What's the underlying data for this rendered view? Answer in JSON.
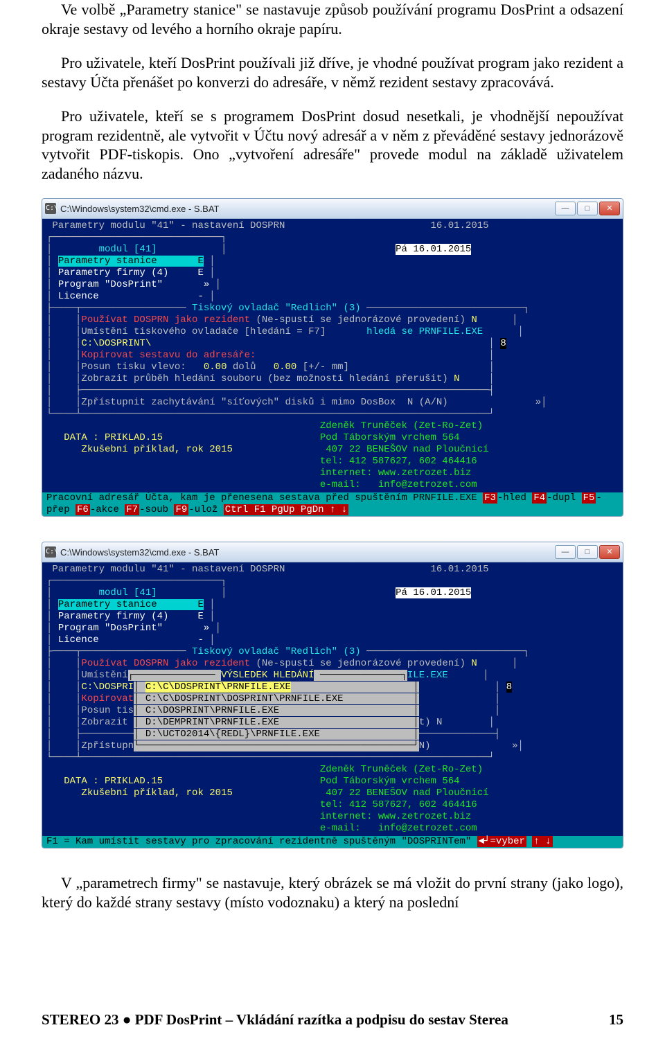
{
  "paragraphs": {
    "p1": "Ve volbě „Parametry stanice\" se nastavuje způsob používání programu DosPrint a odsazení okraje sestavy od levého a horního okraje papíru.",
    "p2": "Pro uživatele, kteří DosPrint používali již dříve, je vhodné používat program jako rezident a sestavy Účta přenášet po konverzi do adresáře, v němž rezident sestavy zpracovává.",
    "p3": "Pro uživatele, kteří se s programem DosPrint dosud nesetkali, je vhodnější nepoužívat program rezidentně, ale vytvořit v Účtu nový adresář a v něm z převáděné sestavy jednorázově vytvořit PDF-tiskopis. Ono „vytvoření adresáře\" provede modul na základě uživatelem zadaného názvu.",
    "p4": "V „parametrech firmy\" se nastavuje, který obrázek se má vložit do první strany (jako logo), který do každé strany sestavy (místo vodoznaku) a který na poslední"
  },
  "window": {
    "title": "C:\\Windows\\system32\\cmd.exe - S.BAT",
    "btn_min": "—",
    "btn_max": "□",
    "btn_close": "✕"
  },
  "screen1": {
    "hdr_left": "Parametry modulu \"41\" - nastavení DOSPRN",
    "hdr_right": "16.01.2015",
    "date_box": "Pá 16.01.2015",
    "menu_title": "modul [41]",
    "menu": [
      {
        "label": "Parametry stanice",
        "flag": "E",
        "sel": true
      },
      {
        "label": "Parametry firmy (4)",
        "flag": "E",
        "sel": false
      },
      {
        "label": "Program \"DosPrint\"",
        "flag": "»",
        "sel": false
      },
      {
        "label": "Licence",
        "flag": "-",
        "sel": false
      }
    ],
    "panel_title": "Tiskový ovladač \"Redlich\" (3)",
    "line1_a": "Používat DOSPRN jako rezident",
    "line1_b": "(Ne-spustí se jednorázové provedení)",
    "line1_c": "N",
    "line2_a": "Umístění tiskového ovladače [hledání = F7]",
    "line2_b": "hledá se PRNFILE.EXE",
    "line3": "C:\\DOSPRINT\\",
    "line4": "Kopírovat sestavu do adresáře:",
    "line5": "Posun tisku vlevo:   0.00 dolů   0.00 [+/- mm]",
    "line6": "Zobrazit průběh hledání souboru (bez možnosti hledání přerušit) N",
    "line7": "Zpřístupnit zachytávání \"síťových\" disků i mimo DosBox  N (A/N)               »",
    "data1": "DATA : PRIKLAD.15",
    "data2": "   Zkušební příklad, rok 2015",
    "contact": [
      "Zdeněk Truněček (Zet-Ro-Zet)",
      "Pod Táborským vrchem 564",
      "407 22 BENEŠOV nad Ploučnicí",
      "tel: 412 587627, 602 464416",
      "internet: www.zetrozet.biz",
      "e-mail:   info@zetrozet.com"
    ],
    "status": "Pracovní adresář Účta, kam je přenesena sestava před spuštěním PRNFILE.EXE",
    "fkeys": [
      [
        "F3",
        "hled"
      ],
      [
        "F4",
        "dupl"
      ],
      [
        "F5",
        "přep"
      ],
      [
        "F6",
        "akce"
      ],
      [
        "F7",
        "soub"
      ],
      [
        "F9",
        "ulož"
      ]
    ],
    "fkeys_right": "Ctrl F1 PgUp PgDn ↑ ↓",
    "side_8": "8"
  },
  "screen2": {
    "line1_a": "Používat DOSPRN jako rezident",
    "line1_b": "(Ne-spustí se jednorázové provedení)",
    "line1_c": "N",
    "popup_title": "VÝSLEDEK HLEDÁNÍ",
    "ile": "ILE.EXE",
    "left": [
      "Umístění",
      "C:\\DOSPRI",
      "Kopírovat",
      "Posun tis",
      "Zobrazit"
    ],
    "results": [
      {
        "p": "C:\\C\\DOSPRINT\\PRNFILE.EXE",
        "sel": true
      },
      {
        "p": "C:\\C\\DOSPRINT\\DOSPRINT\\PRNFILE.EXE",
        "sel": false
      },
      {
        "p": "C:\\DOSPRINT\\PRNFILE.EXE",
        "sel": false
      },
      {
        "p": "D:\\DEMPRINT\\PRNFILE.EXE",
        "sel": false
      },
      {
        "p": "D:\\UCTO2014\\{REDL}\\PRNFILE.EXE",
        "sel": false
      }
    ],
    "right_t": "t) N",
    "right_n": "N)              »",
    "zpri": "Zpřístupn",
    "status": "F1 = Kam umístit sestavy pro zpracování rezidentně spuštěným \"DOSPRINTem\"",
    "fbar": "◄┘=vyber",
    "fbar_right": "↑ ↓"
  },
  "footer": {
    "left": "STEREO 23 ● PDF DosPrint – Vkládání razítka a podpisu do sestav Sterea",
    "right": "15"
  }
}
